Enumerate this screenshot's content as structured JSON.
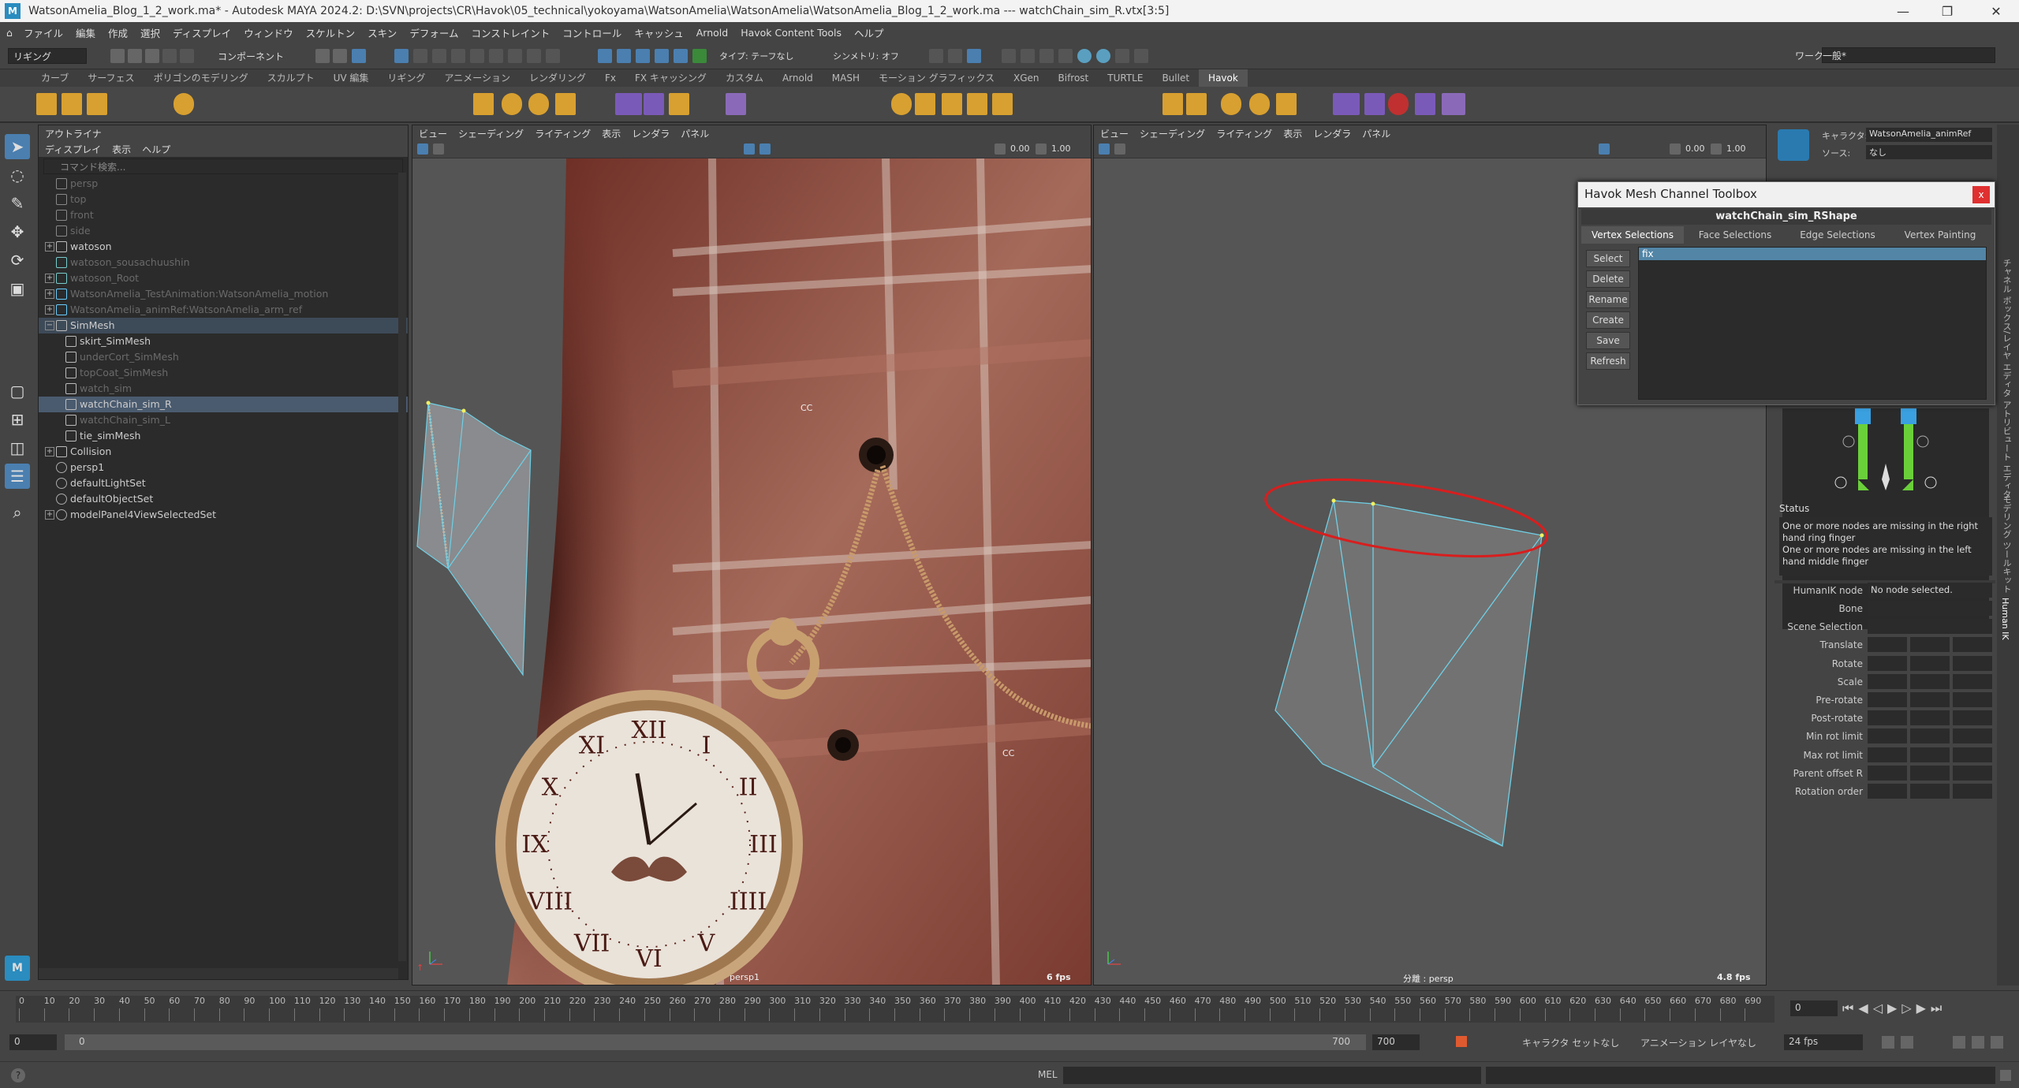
{
  "window": {
    "title": "WatsonAmelia_Blog_1_2_work.ma* - Autodesk MAYA 2024.2: D:\\SVN\\projects\\CR\\Havok\\05_technical\\yokoyama\\WatsonAmelia\\WatsonAmelia\\WatsonAmelia_Blog_1_2_work.ma   ---   watchChain_sim_R.vtx[3:5]",
    "logo": "M"
  },
  "menubar": [
    "ファイル",
    "編集",
    "作成",
    "選択",
    "ディスプレイ",
    "ウィンドウ",
    "スケルトン",
    "スキン",
    "デフォーム",
    "コンストレイント",
    "コントロール",
    "キャッシュ",
    "Arnold",
    "Havok Content Tools",
    "ヘルプ"
  ],
  "toolbar": {
    "mode": "リギング",
    "component": "コンポーネント",
    "symmetry_label": "タイプ: テーフなし",
    "symmetry": "シンメトリ: オフ",
    "workspace_label": "ワークスペース:",
    "workspace": "一般*"
  },
  "shelf_tabs": [
    "カーブ",
    "サーフェス",
    "ポリゴンのモデリング",
    "スカルプト",
    "UV 編集",
    "リギング",
    "アニメーション",
    "レンダリング",
    "Fx",
    "FX キャッシング",
    "カスタム",
    "Arnold",
    "MASH",
    "モーション グラフィックス",
    "XGen",
    "Bifrost",
    "TURTLE",
    "Bullet",
    "Havok"
  ],
  "shelf_active": "Havok",
  "outliner": {
    "title": "アウトライナ",
    "menu": [
      "ディスプレイ",
      "表示",
      "ヘルプ"
    ],
    "search_placeholder": "コマンド検索...",
    "rows": [
      {
        "label": "persp",
        "depth": 0,
        "dim": true,
        "expand": false,
        "icon": "camera"
      },
      {
        "label": "top",
        "depth": 0,
        "dim": true,
        "expand": false,
        "icon": "camera"
      },
      {
        "label": "front",
        "depth": 0,
        "dim": true,
        "expand": false,
        "icon": "camera"
      },
      {
        "label": "side",
        "depth": 0,
        "dim": true,
        "expand": false,
        "icon": "camera"
      },
      {
        "label": "watoson",
        "depth": 0,
        "dim": false,
        "expand": true,
        "icon": "mesh"
      },
      {
        "label": "watoson_sousachuushin",
        "depth": 0,
        "dim": true,
        "expand": false,
        "icon": "joint"
      },
      {
        "label": "watoson_Root",
        "depth": 0,
        "dim": true,
        "expand": true,
        "icon": "joint"
      },
      {
        "label": "WatsonAmelia_TestAnimation:WatsonAmelia_motion",
        "depth": 0,
        "dim": true,
        "expand": true,
        "icon": "star"
      },
      {
        "label": "WatsonAmelia_animRef:WatsonAmelia_arm_ref",
        "depth": 0,
        "dim": true,
        "expand": true,
        "icon": "star"
      },
      {
        "label": "SimMesh",
        "depth": 0,
        "dim": false,
        "expand": true,
        "open": true,
        "icon": "mesh",
        "hi": true
      },
      {
        "label": "skirt_SimMesh",
        "depth": 1,
        "dim": false,
        "expand": false,
        "icon": "mesh"
      },
      {
        "label": "underCort_SimMesh",
        "depth": 1,
        "dim": true,
        "expand": false,
        "icon": "mesh"
      },
      {
        "label": "topCoat_SimMesh",
        "depth": 1,
        "dim": true,
        "expand": false,
        "icon": "mesh"
      },
      {
        "label": "watch_sim",
        "depth": 1,
        "dim": true,
        "expand": false,
        "icon": "mesh"
      },
      {
        "label": "watchChain_sim_R",
        "depth": 1,
        "dim": false,
        "expand": false,
        "icon": "mesh",
        "sel": true
      },
      {
        "label": "watchChain_sim_L",
        "depth": 1,
        "dim": true,
        "expand": false,
        "icon": "mesh"
      },
      {
        "label": "tie_simMesh",
        "depth": 1,
        "dim": false,
        "expand": false,
        "icon": "mesh"
      },
      {
        "label": "Collision",
        "depth": 0,
        "dim": false,
        "expand": true,
        "icon": "mesh"
      },
      {
        "label": "persp1",
        "depth": 0,
        "dim": false,
        "expand": false,
        "icon": "set"
      },
      {
        "label": "defaultLightSet",
        "depth": 0,
        "dim": false,
        "expand": false,
        "icon": "set"
      },
      {
        "label": "defaultObjectSet",
        "depth": 0,
        "dim": false,
        "expand": false,
        "icon": "set"
      },
      {
        "label": "modelPanel4ViewSelectedSet",
        "depth": 0,
        "dim": false,
        "expand": true,
        "icon": "set"
      }
    ]
  },
  "viewport_left": {
    "menu": [
      "ビュー",
      "シェーディング",
      "ライティング",
      "表示",
      "レンダラ",
      "パネル"
    ],
    "val1": "0.00",
    "val2": "1.00",
    "camera": "persp1",
    "fps": "6 fps",
    "cc1": "CC",
    "cc2": "CC",
    "roman": [
      "XII",
      "I",
      "II",
      "III",
      "IIII",
      "V",
      "VI",
      "VII",
      "VIII",
      "IX",
      "X",
      "XI"
    ]
  },
  "viewport_right": {
    "menu": [
      "ビュー",
      "シェーディング",
      "ライティング",
      "表示",
      "レンダラ",
      "パネル"
    ],
    "val1": "0.00",
    "val2": "1.00",
    "camera": "分離 : persp",
    "fps": "4.8 fps"
  },
  "havok_dialog": {
    "title": "Havok Mesh Channel Toolbox",
    "close": "x",
    "shape": "watchChain_sim_RShape",
    "tabs": [
      "Vertex Selections",
      "Face Selections",
      "Edge Selections",
      "Vertex Painting"
    ],
    "buttons": [
      "Select",
      "Delete",
      "Rename",
      "Create",
      "Save",
      "Refresh"
    ],
    "list": [
      "fix"
    ]
  },
  "humanik": {
    "character_label": "キャラクタ:",
    "character": "WatsonAmelia_animRef",
    "source_label": "ソース:",
    "source": "なし",
    "status_title": "Status",
    "status_text": "One or more nodes are missing in the right hand ring finger\nOne or more nodes are missing in the left hand middle finger",
    "node_label": "HumanIK node",
    "node_value": "No node selected.",
    "fields": [
      "Bone",
      "Scene Selection",
      "Translate",
      "Rotate",
      "Scale",
      "Pre-rotate",
      "Post-rotate",
      "Min rot limit",
      "Max rot limit",
      "Parent offset R",
      "Rotation order"
    ]
  },
  "vertical_tabs": [
    "チャネル ボックス/レイヤ エディタ",
    "アトリビュート エディタ",
    "モデリング ツールキット",
    "Human IK"
  ],
  "timeline": {
    "ticks": [
      0,
      10,
      20,
      30,
      40,
      50,
      60,
      70,
      80,
      90,
      100,
      110,
      120,
      130,
      140,
      150,
      160,
      170,
      180,
      190,
      200,
      210,
      220,
      230,
      240,
      250,
      260,
      270,
      280,
      290,
      300,
      310,
      320,
      330,
      340,
      350,
      360,
      370,
      380,
      390,
      400,
      410,
      420,
      430,
      440,
      450,
      460,
      470,
      480,
      490,
      500,
      510,
      520,
      530,
      540,
      550,
      560,
      570,
      580,
      590,
      600,
      610,
      620,
      630,
      640,
      650,
      660,
      670,
      680,
      690
    ],
    "current": "0"
  },
  "range": {
    "start": "0",
    "inner_start": "0",
    "inner_end": "700",
    "end": "700",
    "char_set": "キャラクタ セットなし",
    "anim_layer": "アニメーション レイヤなし",
    "fps": "24 fps"
  },
  "cmdline": {
    "label": "MEL"
  },
  "colors": {
    "accent": "#5285a6",
    "close": "#e03030",
    "wire": "#6fd0e6",
    "annotation": "#d81e1e"
  }
}
